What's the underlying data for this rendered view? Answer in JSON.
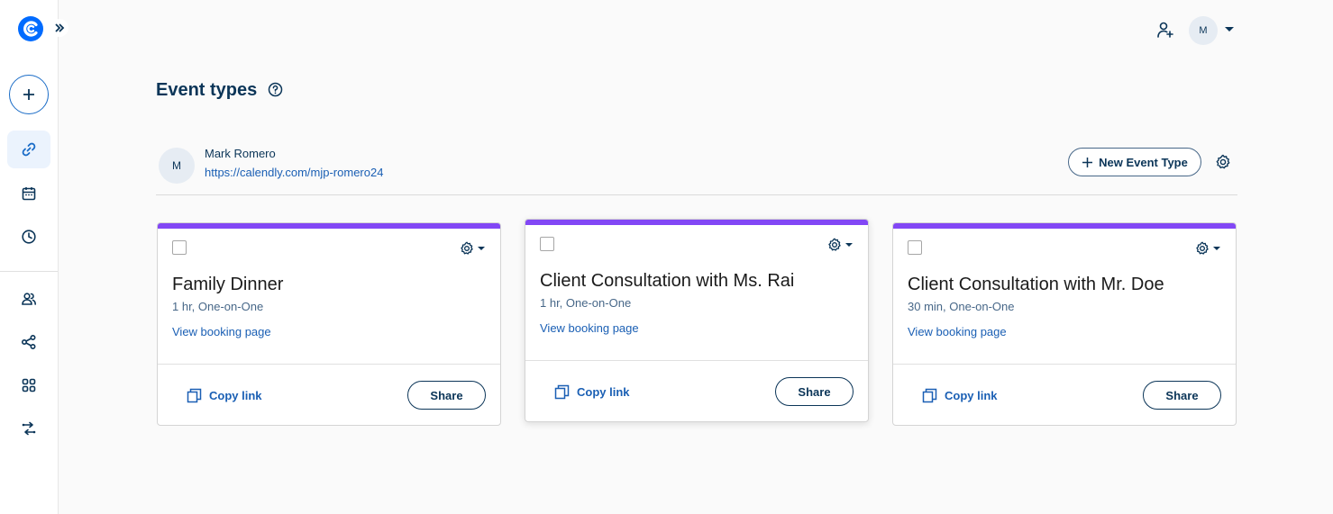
{
  "nav": {
    "brand_icon": "calendly-logo",
    "expand_icon": "double-chevron-right-icon",
    "create_icon": "plus-icon",
    "items": [
      {
        "id": "links",
        "icon": "link-icon",
        "active": true
      },
      {
        "id": "meetings",
        "icon": "calendar-icon",
        "active": false
      },
      {
        "id": "availability",
        "icon": "clock-icon",
        "active": false
      },
      {
        "id": "contacts",
        "icon": "people-icon",
        "active": false
      },
      {
        "id": "workflows",
        "icon": "workflow-icon",
        "active": false
      },
      {
        "id": "integrations",
        "icon": "apps-grid-icon",
        "active": false
      },
      {
        "id": "routing",
        "icon": "routing-icon",
        "active": false
      }
    ]
  },
  "topbar": {
    "invite_icon": "add-user-icon",
    "avatar_initial": "M"
  },
  "page": {
    "title": "Event types"
  },
  "user": {
    "initial": "M",
    "name": "Mark Romero",
    "link": "https://calendly.com/mjp-romero24"
  },
  "actions": {
    "new_event_label": "New Event Type"
  },
  "colors": {
    "accent": "#8247f5",
    "link": "#1a5fb4",
    "text": "#0b3558"
  },
  "cards": [
    {
      "title": "Family Dinner",
      "subtitle": "1 hr, One-on-One",
      "view_label": "View booking page",
      "copy_label": "Copy link",
      "share_label": "Share"
    },
    {
      "title": "Client Consultation with Ms. Rai",
      "subtitle": "1 hr, One-on-One",
      "view_label": "View booking page",
      "copy_label": "Copy link",
      "share_label": "Share"
    },
    {
      "title": "Client Consultation with Mr. Doe",
      "subtitle": "30 min, One-on-One",
      "view_label": "View booking page",
      "copy_label": "Copy link",
      "share_label": "Share"
    }
  ]
}
